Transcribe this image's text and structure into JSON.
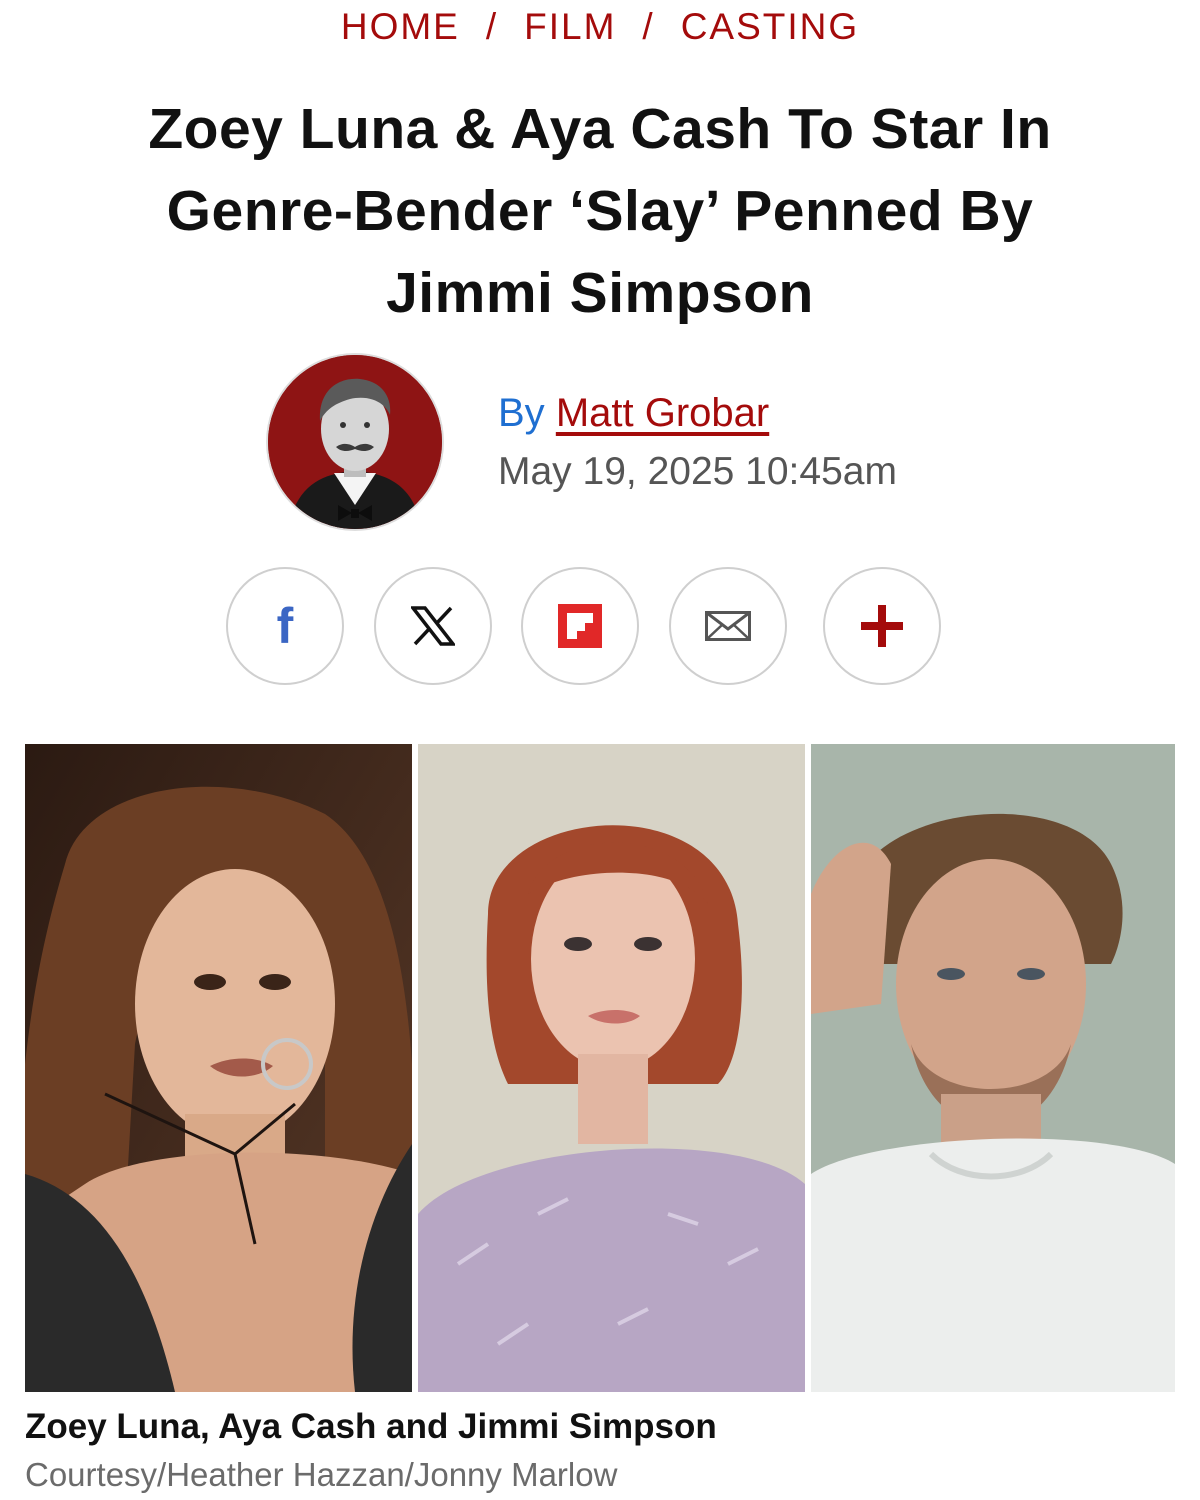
{
  "breadcrumb": {
    "items": [
      "HOME",
      "FILM",
      "CASTING"
    ],
    "separator": "/"
  },
  "article": {
    "headline_lines": [
      "Zoey Luna & Aya Cash To Star In",
      "Genre-Bender ‘Slay’ Penned By",
      "Jimmi Simpson"
    ],
    "byline_prefix": "By",
    "author": "Matt Grobar",
    "timestamp": "May 19, 2025 10:45am"
  },
  "share": {
    "buttons": [
      {
        "id": "facebook",
        "icon": "facebook-icon",
        "glyph": "f",
        "color": "#3b66c4"
      },
      {
        "id": "x",
        "icon": "x-icon",
        "glyph": "𝕏",
        "color": "#111111"
      },
      {
        "id": "flipboard",
        "icon": "flipboard-icon",
        "color": "#e12828"
      },
      {
        "id": "email",
        "icon": "envelope-icon",
        "color": "#555555"
      },
      {
        "id": "more",
        "icon": "plus-icon",
        "glyph": "+",
        "color": "#a40b0b"
      }
    ]
  },
  "media": {
    "photos": [
      "zoey-luna-photo",
      "aya-cash-photo",
      "jimmi-simpson-photo"
    ],
    "caption": "Zoey Luna, Aya Cash and Jimmi Simpson",
    "credit": "Courtesy/Heather Hazzan/Jonny Marlow"
  },
  "colors": {
    "accent": "#a40b0b",
    "link_blue": "#1f6fd1",
    "text": "#111111",
    "muted": "#555555"
  }
}
